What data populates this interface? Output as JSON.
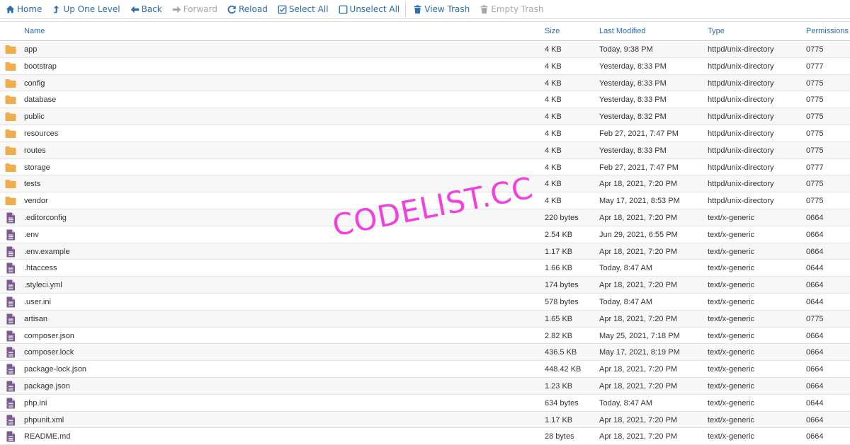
{
  "toolbar": {
    "home": "Home",
    "up_one_level": "Up One Level",
    "back": "Back",
    "forward": "Forward",
    "reload": "Reload",
    "select_all": "Select All",
    "unselect_all": "Unselect All",
    "view_trash": "View Trash",
    "empty_trash": "Empty Trash"
  },
  "columns": {
    "name": "Name",
    "size": "Size",
    "last_modified": "Last Modified",
    "type": "Type",
    "permissions": "Permissions"
  },
  "files": [
    {
      "icon": "folder-icon",
      "name": "app",
      "size": "4 KB",
      "modified": "Today, 9:38 PM",
      "type": "httpd/unix-directory",
      "perm": "0775"
    },
    {
      "icon": "folder-icon",
      "name": "bootstrap",
      "size": "4 KB",
      "modified": "Yesterday, 8:33 PM",
      "type": "httpd/unix-directory",
      "perm": "0777"
    },
    {
      "icon": "folder-icon",
      "name": "config",
      "size": "4 KB",
      "modified": "Yesterday, 8:33 PM",
      "type": "httpd/unix-directory",
      "perm": "0775"
    },
    {
      "icon": "folder-icon",
      "name": "database",
      "size": "4 KB",
      "modified": "Yesterday, 8:33 PM",
      "type": "httpd/unix-directory",
      "perm": "0775"
    },
    {
      "icon": "folder-icon",
      "name": "public",
      "size": "4 KB",
      "modified": "Yesterday, 8:32 PM",
      "type": "httpd/unix-directory",
      "perm": "0775"
    },
    {
      "icon": "folder-icon",
      "name": "resources",
      "size": "4 KB",
      "modified": "Feb 27, 2021, 7:47 PM",
      "type": "httpd/unix-directory",
      "perm": "0775"
    },
    {
      "icon": "folder-icon",
      "name": "routes",
      "size": "4 KB",
      "modified": "Yesterday, 8:33 PM",
      "type": "httpd/unix-directory",
      "perm": "0775"
    },
    {
      "icon": "folder-icon",
      "name": "storage",
      "size": "4 KB",
      "modified": "Feb 27, 2021, 7:47 PM",
      "type": "httpd/unix-directory",
      "perm": "0777"
    },
    {
      "icon": "folder-icon",
      "name": "tests",
      "size": "4 KB",
      "modified": "Apr 18, 2021, 7:20 PM",
      "type": "httpd/unix-directory",
      "perm": "0775"
    },
    {
      "icon": "folder-icon",
      "name": "vendor",
      "size": "4 KB",
      "modified": "May 17, 2021, 8:53 PM",
      "type": "httpd/unix-directory",
      "perm": "0775"
    },
    {
      "icon": "file-icon",
      "name": ".editorconfig",
      "size": "220 bytes",
      "modified": "Apr 18, 2021, 7:20 PM",
      "type": "text/x-generic",
      "perm": "0664"
    },
    {
      "icon": "file-icon",
      "name": ".env",
      "size": "2.54 KB",
      "modified": "Jun 29, 2021, 6:55 PM",
      "type": "text/x-generic",
      "perm": "0664"
    },
    {
      "icon": "file-icon",
      "name": ".env.example",
      "size": "1.17 KB",
      "modified": "Apr 18, 2021, 7:20 PM",
      "type": "text/x-generic",
      "perm": "0664"
    },
    {
      "icon": "file-icon",
      "name": ".htaccess",
      "size": "1.66 KB",
      "modified": "Today, 8:47 AM",
      "type": "text/x-generic",
      "perm": "0644"
    },
    {
      "icon": "file-icon",
      "name": ".styleci.yml",
      "size": "174 bytes",
      "modified": "Apr 18, 2021, 7:20 PM",
      "type": "text/x-generic",
      "perm": "0664"
    },
    {
      "icon": "file-icon",
      "name": ".user.ini",
      "size": "578 bytes",
      "modified": "Today, 8:47 AM",
      "type": "text/x-generic",
      "perm": "0644"
    },
    {
      "icon": "file-icon",
      "name": "artisan",
      "size": "1.65 KB",
      "modified": "Apr 18, 2021, 7:20 PM",
      "type": "text/x-generic",
      "perm": "0775"
    },
    {
      "icon": "file-icon",
      "name": "composer.json",
      "size": "2.82 KB",
      "modified": "May 25, 2021, 7:18 PM",
      "type": "text/x-generic",
      "perm": "0664"
    },
    {
      "icon": "file-icon",
      "name": "composer.lock",
      "size": "436.5 KB",
      "modified": "May 17, 2021, 8:19 PM",
      "type": "text/x-generic",
      "perm": "0664"
    },
    {
      "icon": "file-icon",
      "name": "package-lock.json",
      "size": "448.42 KB",
      "modified": "Apr 18, 2021, 7:20 PM",
      "type": "text/x-generic",
      "perm": "0664"
    },
    {
      "icon": "file-icon",
      "name": "package.json",
      "size": "1.23 KB",
      "modified": "Apr 18, 2021, 7:20 PM",
      "type": "text/x-generic",
      "perm": "0664"
    },
    {
      "icon": "file-icon",
      "name": "php.ini",
      "size": "634 bytes",
      "modified": "Today, 8:47 AM",
      "type": "text/x-generic",
      "perm": "0644"
    },
    {
      "icon": "file-icon",
      "name": "phpunit.xml",
      "size": "1.17 KB",
      "modified": "Apr 18, 2021, 7:20 PM",
      "type": "text/x-generic",
      "perm": "0664"
    },
    {
      "icon": "file-icon",
      "name": "README.md",
      "size": "28 bytes",
      "modified": "Apr 18, 2021, 7:20 PM",
      "type": "text/x-generic",
      "perm": "0664"
    }
  ],
  "watermark": "CODELIST.CC",
  "colors": {
    "link": "#2a6db0",
    "disabled": "#a8a8a8",
    "folder": "#f0ad4e",
    "file": "#7b5a92",
    "watermark": "#f23fe0"
  }
}
